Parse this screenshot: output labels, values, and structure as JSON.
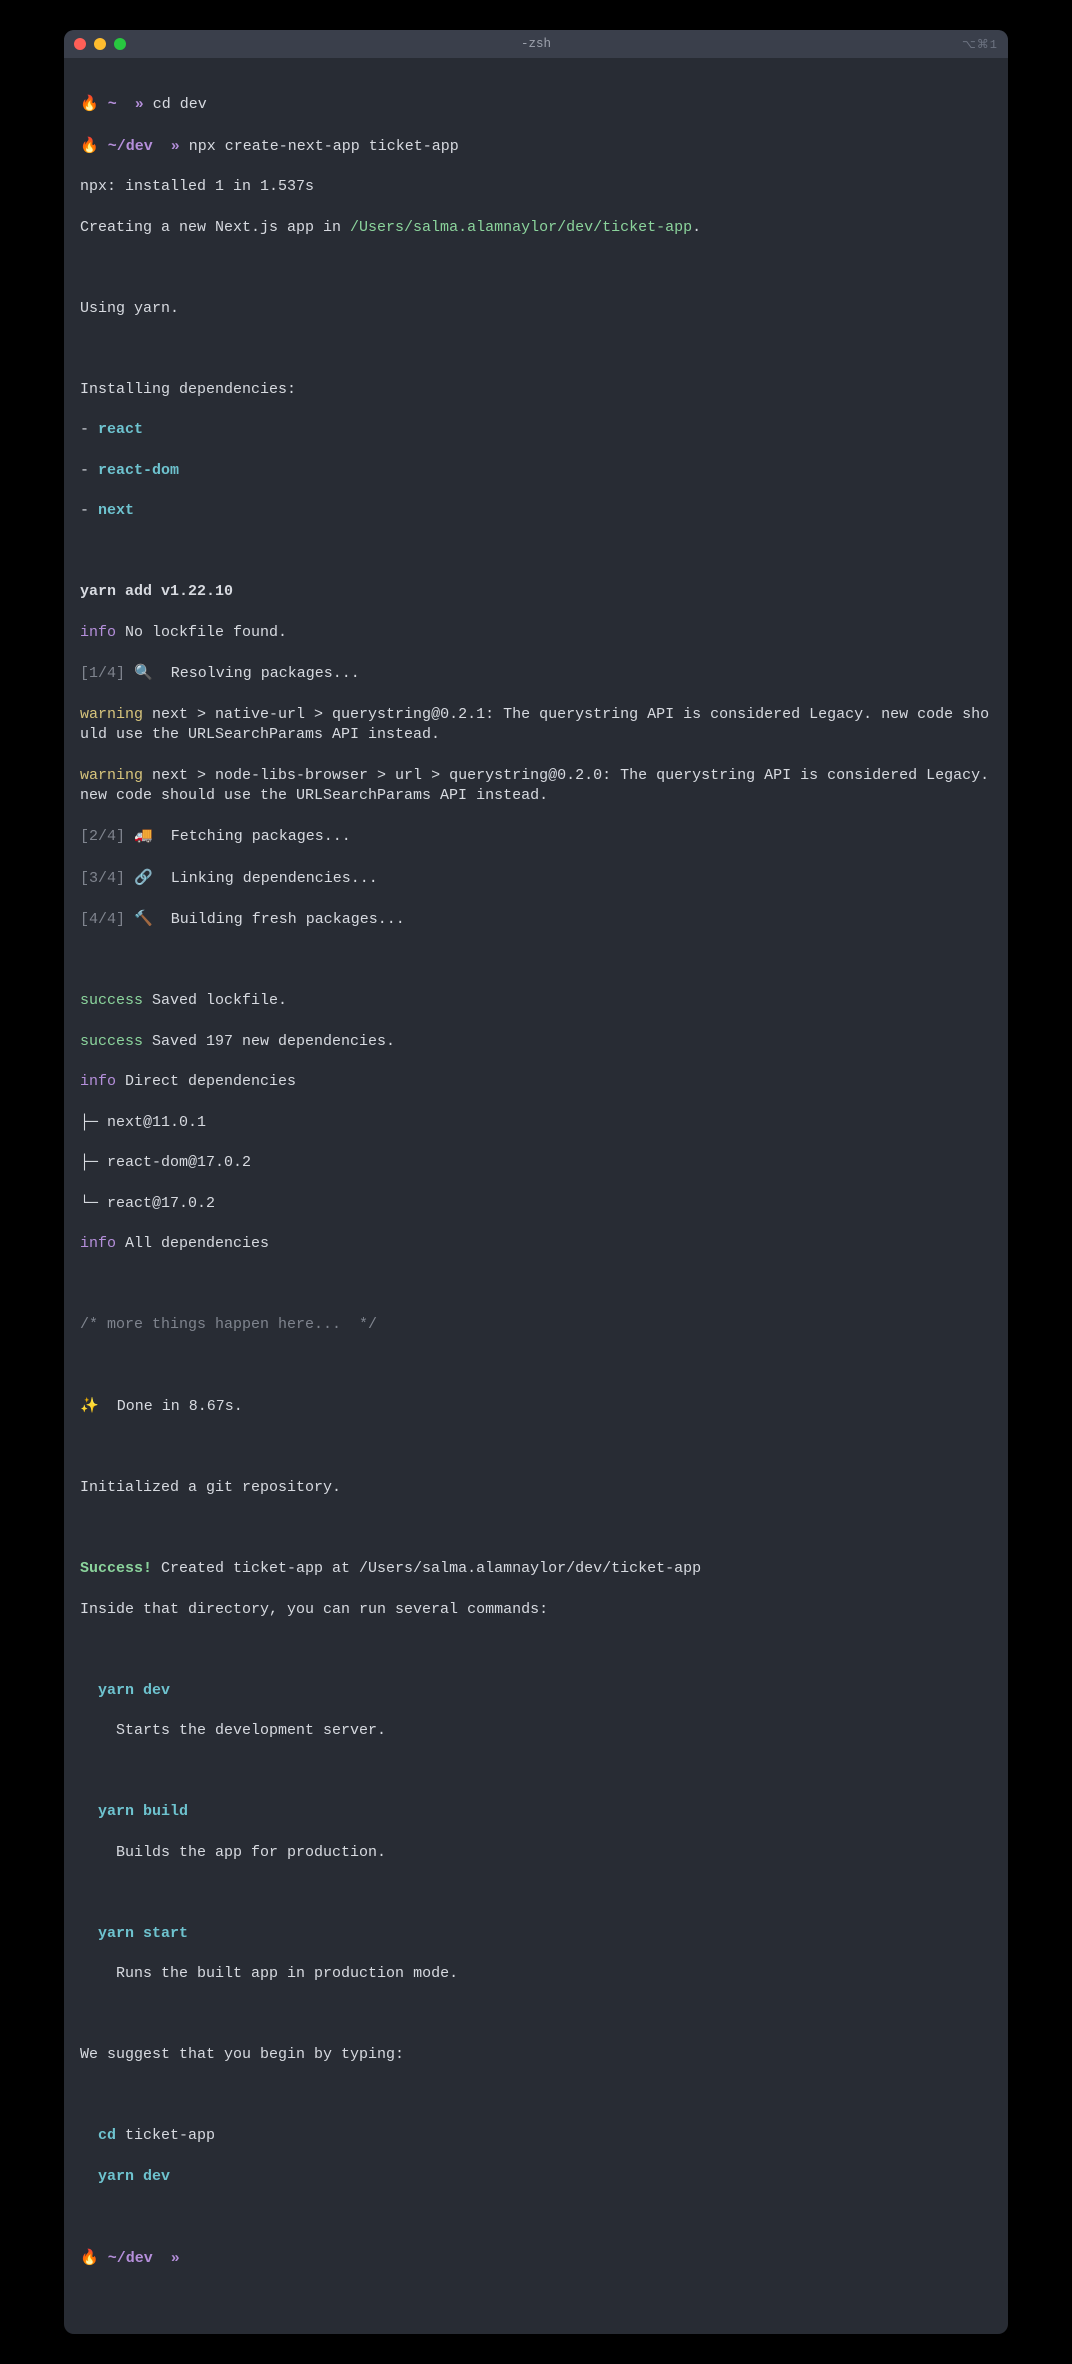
{
  "window": {
    "title": "-zsh",
    "right_hint": "⌥⌘1"
  },
  "p1": {
    "fire": "🔥",
    "path": "~",
    "arrows": "»",
    "cmd": "cd dev"
  },
  "p2": {
    "fire": "🔥",
    "path": "~/dev",
    "arrows": "»",
    "cmd": "npx create-next-app ticket-app"
  },
  "lines": {
    "npx_installed": "npx: installed 1 in 1.537s",
    "creating_prefix": "Creating a new Next.js app in ",
    "creating_path": "/Users/salma.alamnaylor/dev/ticket-app",
    "creating_period": ".",
    "using_yarn": "Using yarn.",
    "installing_deps": "Installing dependencies:",
    "dep_dash": "- ",
    "dep_react": "react",
    "dep_react_dom": "react-dom",
    "dep_next": "next",
    "yarn_add": "yarn add v1.22.10",
    "info1_label": "info",
    "info1_text": " No lockfile found.",
    "step1_label": "[1/4]",
    "step1_emoji": "🔍",
    "step1_text": "  Resolving packages...",
    "warn1_label": "warning",
    "warn1_text": " next > native-url > querystring@0.2.1: The querystring API is considered Legacy. new code should use the URLSearchParams API instead.",
    "warn2_label": "warning",
    "warn2_text": " next > node-libs-browser > url > querystring@0.2.0: The querystring API is considered Legacy. new code should use the URLSearchParams API instead.",
    "step2_label": "[2/4]",
    "step2_emoji": "🚚",
    "step2_text": "  Fetching packages...",
    "step3_label": "[3/4]",
    "step3_emoji": "🔗",
    "step3_text": "  Linking dependencies...",
    "step4_label": "[4/4]",
    "step4_emoji": "🔨",
    "step4_text": "  Building fresh packages...",
    "succ1_label": "success",
    "succ1_text": " Saved lockfile.",
    "succ2_label": "success",
    "succ2_text": " Saved 197 new dependencies.",
    "info2_label": "info",
    "info2_text": " Direct dependencies",
    "tree1": "├─ next@11.0.1",
    "tree2": "├─ react-dom@17.0.2",
    "tree3": "└─ react@17.0.2",
    "info3_label": "info",
    "info3_text": " All dependencies",
    "comment": "/* more things happen here...  */",
    "done_emoji": "✨",
    "done_text": "  Done in 8.67s.",
    "git_init": "Initialized a git repository.",
    "success_label": "Success!",
    "success_text": " Created ticket-app at /Users/salma.alamnaylor/dev/ticket-app",
    "inside_text": "Inside that directory, you can run several commands:",
    "yd": "  yarn dev",
    "yd_desc": "    Starts the development server.",
    "yb": "  yarn build",
    "yb_desc": "    Builds the app for production.",
    "ys": "  yarn start",
    "ys_desc": "    Runs the built app in production mode.",
    "suggest": "We suggest that you begin by typing:",
    "cd_cmd_prefix": "  cd",
    "cd_cmd_arg": " ticket-app",
    "yd2": "  yarn dev"
  },
  "p3": {
    "fire": "🔥",
    "path": "~/dev",
    "arrows": "»"
  }
}
